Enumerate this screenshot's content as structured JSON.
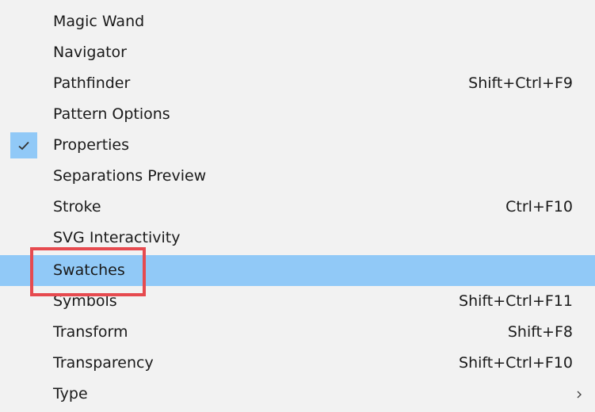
{
  "menu": {
    "highlight_color": "#91c9f7",
    "callout_color": "#e64a4f",
    "items": [
      {
        "label": "Magic Wand",
        "shortcut": ""
      },
      {
        "label": "Navigator",
        "shortcut": ""
      },
      {
        "label": "Pathfinder",
        "shortcut": "Shift+Ctrl+F9"
      },
      {
        "label": "Pattern Options",
        "shortcut": ""
      },
      {
        "label": "Properties",
        "shortcut": "",
        "checked": true
      },
      {
        "label": "Separations Preview",
        "shortcut": ""
      },
      {
        "label": "Stroke",
        "shortcut": "Ctrl+F10"
      },
      {
        "label": "SVG Interactivity",
        "shortcut": ""
      },
      {
        "label": "Swatches",
        "shortcut": "",
        "highlighted": true
      },
      {
        "label": "Symbols",
        "shortcut": "Shift+Ctrl+F11"
      },
      {
        "label": "Transform",
        "shortcut": "Shift+F8"
      },
      {
        "label": "Transparency",
        "shortcut": "Shift+Ctrl+F10"
      },
      {
        "label": "Type",
        "shortcut": "",
        "submenu": true,
        "submenu_icon": "chevron-right-icon"
      }
    ],
    "check_icon": "checkmark-icon"
  }
}
